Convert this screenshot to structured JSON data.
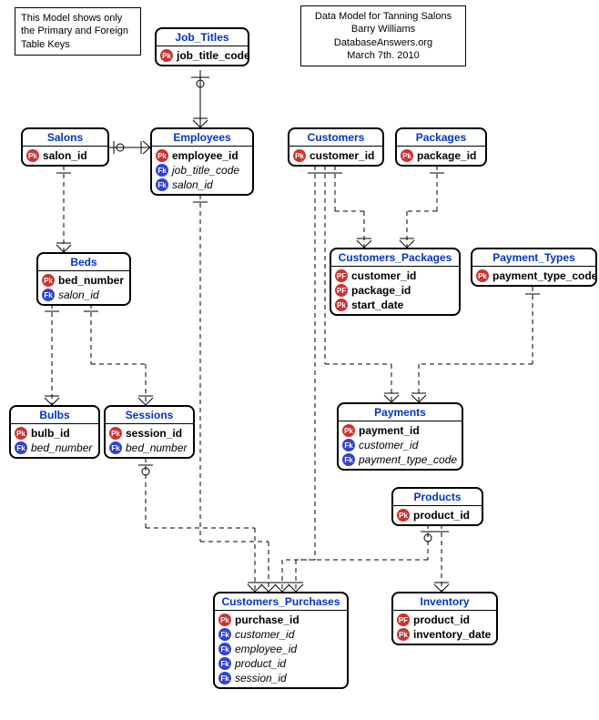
{
  "notes": {
    "left": {
      "line1": "This Model shows only",
      "line2": "the Primary and Foreign",
      "line3": "Table Keys"
    },
    "right": {
      "line1": "Data Model for Tanning Salons",
      "line2": "Barry Williams",
      "line3": "DatabaseAnswers.org",
      "line4": "March 7th. 2010"
    }
  },
  "key_labels": {
    "pk": "Pk",
    "fk": "Fk",
    "pf": "PF"
  },
  "entities": {
    "job_titles": {
      "title": "Job_Titles",
      "attrs": [
        {
          "key": "pk",
          "text": "job_title_code"
        }
      ]
    },
    "salons": {
      "title": "Salons",
      "attrs": [
        {
          "key": "pk",
          "text": "salon_id"
        }
      ]
    },
    "employees": {
      "title": "Employees",
      "attrs": [
        {
          "key": "pk",
          "text": "employee_id"
        },
        {
          "key": "fk",
          "text": "job_title_code"
        },
        {
          "key": "fk",
          "text": "salon_id"
        }
      ]
    },
    "customers": {
      "title": "Customers",
      "attrs": [
        {
          "key": "pk",
          "text": "customer_id"
        }
      ]
    },
    "packages": {
      "title": "Packages",
      "attrs": [
        {
          "key": "pk",
          "text": "package_id"
        }
      ]
    },
    "beds": {
      "title": "Beds",
      "attrs": [
        {
          "key": "pk",
          "text": "bed_number"
        },
        {
          "key": "fk",
          "text": "salon_id"
        }
      ]
    },
    "customers_packages": {
      "title": "Customers_Packages",
      "attrs": [
        {
          "key": "pf",
          "text": "customer_id"
        },
        {
          "key": "pf",
          "text": "package_id"
        },
        {
          "key": "pk",
          "text": "start_date"
        }
      ]
    },
    "payment_types": {
      "title": "Payment_Types",
      "attrs": [
        {
          "key": "pk",
          "text": "payment_type_code"
        }
      ]
    },
    "bulbs": {
      "title": "Bulbs",
      "attrs": [
        {
          "key": "pk",
          "text": "bulb_id"
        },
        {
          "key": "fk",
          "text": "bed_number"
        }
      ]
    },
    "sessions": {
      "title": "Sessions",
      "attrs": [
        {
          "key": "pk",
          "text": "session_id"
        },
        {
          "key": "fk",
          "text": "bed_number"
        }
      ]
    },
    "payments": {
      "title": "Payments",
      "attrs": [
        {
          "key": "pk",
          "text": "payment_id"
        },
        {
          "key": "fk",
          "text": "customer_id"
        },
        {
          "key": "fk",
          "text": "payment_type_code"
        }
      ]
    },
    "products": {
      "title": "Products",
      "attrs": [
        {
          "key": "pk",
          "text": "product_id"
        }
      ]
    },
    "customers_purchases": {
      "title": "Customers_Purchases",
      "attrs": [
        {
          "key": "pk",
          "text": "purchase_id"
        },
        {
          "key": "fk",
          "text": "customer_id"
        },
        {
          "key": "fk",
          "text": "employee_id"
        },
        {
          "key": "fk",
          "text": "product_id"
        },
        {
          "key": "fk",
          "text": "session_id"
        }
      ]
    },
    "inventory": {
      "title": "Inventory",
      "attrs": [
        {
          "key": "pf",
          "text": "product_id"
        },
        {
          "key": "pk",
          "text": "inventory_date"
        }
      ]
    }
  }
}
